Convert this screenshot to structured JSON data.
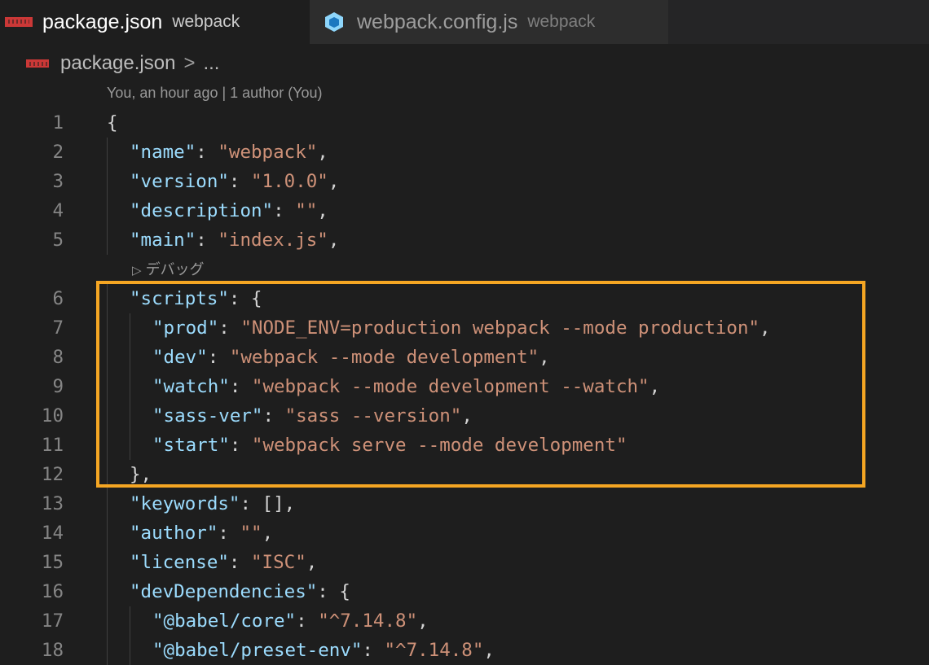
{
  "tabs": [
    {
      "name": "package.json",
      "description": "webpack",
      "icon": "npm-icon",
      "active": true
    },
    {
      "name": "webpack.config.js",
      "description": "webpack",
      "icon": "webpack-cube-icon",
      "active": false
    }
  ],
  "breadcrumb": {
    "file": "package.json",
    "separator": ">",
    "ellipsis": "..."
  },
  "blame": "You, an hour ago | 1 author (You)",
  "debug_lens": "デバッグ",
  "highlight_color": "#f5a623",
  "lines": [
    {
      "n": "1",
      "tokens": [
        {
          "t": "{",
          "c": "p"
        }
      ]
    },
    {
      "n": "2",
      "tokens": [
        {
          "t": "\"name\"",
          "c": "k"
        },
        {
          "t": ": ",
          "c": "p"
        },
        {
          "t": "\"webpack\"",
          "c": "s"
        },
        {
          "t": ",",
          "c": "p"
        }
      ]
    },
    {
      "n": "3",
      "tokens": [
        {
          "t": "\"version\"",
          "c": "k"
        },
        {
          "t": ": ",
          "c": "p"
        },
        {
          "t": "\"1.0.0\"",
          "c": "s"
        },
        {
          "t": ",",
          "c": "p"
        }
      ]
    },
    {
      "n": "4",
      "tokens": [
        {
          "t": "\"description\"",
          "c": "k"
        },
        {
          "t": ": ",
          "c": "p"
        },
        {
          "t": "\"\"",
          "c": "s"
        },
        {
          "t": ",",
          "c": "p"
        }
      ]
    },
    {
      "n": "5",
      "tokens": [
        {
          "t": "\"main\"",
          "c": "k"
        },
        {
          "t": ": ",
          "c": "p"
        },
        {
          "t": "\"index.js\"",
          "c": "s"
        },
        {
          "t": ",",
          "c": "p"
        }
      ]
    },
    {
      "n": "6",
      "tokens": [
        {
          "t": "\"scripts\"",
          "c": "k"
        },
        {
          "t": ": {",
          "c": "p"
        }
      ]
    },
    {
      "n": "7",
      "tokens": [
        {
          "t": "\"prod\"",
          "c": "k"
        },
        {
          "t": ": ",
          "c": "p"
        },
        {
          "t": "\"NODE_ENV=production webpack --mode production\"",
          "c": "s"
        },
        {
          "t": ",",
          "c": "p"
        }
      ]
    },
    {
      "n": "8",
      "tokens": [
        {
          "t": "\"dev\"",
          "c": "k"
        },
        {
          "t": ": ",
          "c": "p"
        },
        {
          "t": "\"webpack --mode development\"",
          "c": "s"
        },
        {
          "t": ",",
          "c": "p"
        }
      ]
    },
    {
      "n": "9",
      "tokens": [
        {
          "t": "\"watch\"",
          "c": "k"
        },
        {
          "t": ": ",
          "c": "p"
        },
        {
          "t": "\"webpack --mode development --watch\"",
          "c": "s"
        },
        {
          "t": ",",
          "c": "p"
        }
      ]
    },
    {
      "n": "10",
      "tokens": [
        {
          "t": "\"sass-ver\"",
          "c": "k"
        },
        {
          "t": ": ",
          "c": "p"
        },
        {
          "t": "\"sass --version\"",
          "c": "s"
        },
        {
          "t": ",",
          "c": "p"
        }
      ]
    },
    {
      "n": "11",
      "tokens": [
        {
          "t": "\"start\"",
          "c": "k"
        },
        {
          "t": ": ",
          "c": "p"
        },
        {
          "t": "\"webpack serve --mode development\"",
          "c": "s"
        }
      ]
    },
    {
      "n": "12",
      "tokens": [
        {
          "t": "},",
          "c": "p"
        }
      ]
    },
    {
      "n": "13",
      "tokens": [
        {
          "t": "\"keywords\"",
          "c": "k"
        },
        {
          "t": ": [],",
          "c": "p"
        }
      ]
    },
    {
      "n": "14",
      "tokens": [
        {
          "t": "\"author\"",
          "c": "k"
        },
        {
          "t": ": ",
          "c": "p"
        },
        {
          "t": "\"\"",
          "c": "s"
        },
        {
          "t": ",",
          "c": "p"
        }
      ]
    },
    {
      "n": "15",
      "tokens": [
        {
          "t": "\"license\"",
          "c": "k"
        },
        {
          "t": ": ",
          "c": "p"
        },
        {
          "t": "\"ISC\"",
          "c": "s"
        },
        {
          "t": ",",
          "c": "p"
        }
      ]
    },
    {
      "n": "16",
      "tokens": [
        {
          "t": "\"devDependencies\"",
          "c": "k"
        },
        {
          "t": ": {",
          "c": "p"
        }
      ]
    },
    {
      "n": "17",
      "tokens": [
        {
          "t": "\"@babel/core\"",
          "c": "k"
        },
        {
          "t": ": ",
          "c": "p"
        },
        {
          "t": "\"^7.14.8\"",
          "c": "s"
        },
        {
          "t": ",",
          "c": "p"
        }
      ]
    },
    {
      "n": "18",
      "tokens": [
        {
          "t": "\"@babel/preset-env\"",
          "c": "k"
        },
        {
          "t": ": ",
          "c": "p"
        },
        {
          "t": "\"^7.14.8\"",
          "c": "s"
        },
        {
          "t": ",",
          "c": "p"
        }
      ]
    }
  ]
}
